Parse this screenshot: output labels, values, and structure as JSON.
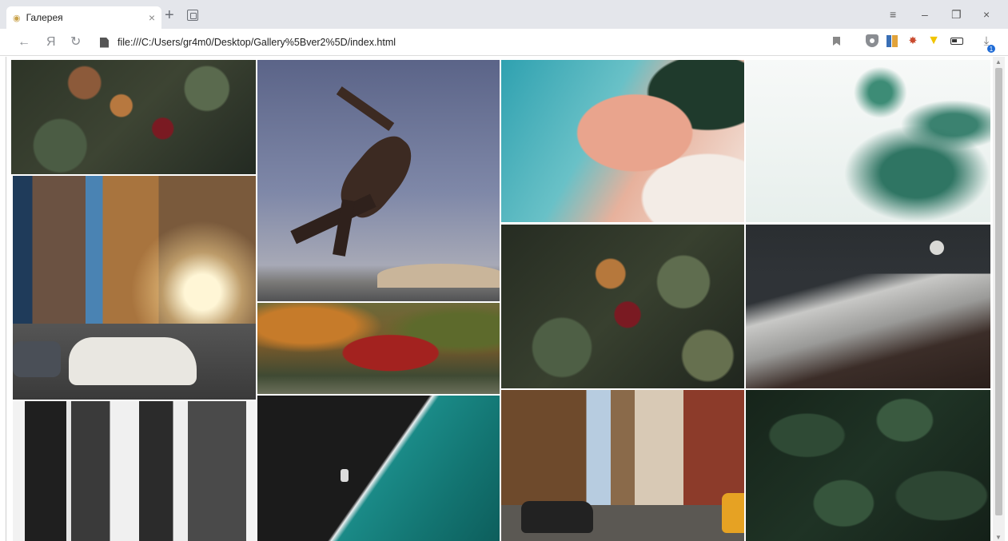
{
  "browser": {
    "tab_title": "Галерея",
    "tab_close": "×",
    "new_tab": "+",
    "address": "file:///C:/Users/gr4m0/Desktop/Gallery%5Bver2%5D/index.html",
    "nav_back": "←",
    "nav_yandex": "Я",
    "nav_reload": "↻",
    "window_menu": "≡",
    "window_minimize": "–",
    "window_restore": "❐",
    "window_close": "×",
    "download_badge": "1"
  },
  "extensions": [
    "shield-icon",
    "books-icon",
    "bug-icon",
    "lightbulb-icon",
    "battery-icon",
    "download-icon"
  ],
  "gallery": {
    "images": [
      {
        "name": "berries-leaves",
        "subject": "autumn leaves with red berries"
      },
      {
        "name": "sprinter",
        "subject": "athlete sprinting against blue sky"
      },
      {
        "name": "aerial-river",
        "subject": "aerial view of coral and teal river delta"
      },
      {
        "name": "fern",
        "subject": "green fern on white fog"
      },
      {
        "name": "city-street",
        "subject": "city street with buildings and white SUV"
      },
      {
        "name": "ivy-house",
        "subject": "house covered in red ivy"
      },
      {
        "name": "berries-leaves-2",
        "subject": "leaves and red berries"
      },
      {
        "name": "mountains-moon",
        "subject": "snowy mountains under moon"
      },
      {
        "name": "friends-walking",
        "subject": "black and white group walking"
      },
      {
        "name": "drone-beach",
        "subject": "aerial of dark beach and teal sea"
      },
      {
        "name": "city-avenue",
        "subject": "city avenue with taxi and cars"
      },
      {
        "name": "green-leaves",
        "subject": "dense green leaves"
      }
    ]
  }
}
